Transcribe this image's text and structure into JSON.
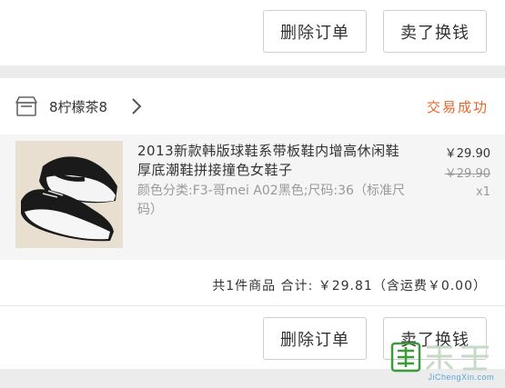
{
  "top_actions": {
    "delete_label": "删除订单",
    "sell_label": "卖了换钱"
  },
  "order": {
    "store_icon": "store-icon",
    "store_name": "8柠檬茶8",
    "status": "交易成功",
    "item": {
      "title": "2013新款韩版球鞋系带板鞋内增高休闲鞋厚底潮鞋拼接撞色女鞋子",
      "spec": "颜色分类:F3-哥mei A02黑色;尺码:36（标准尺码）",
      "price": "￥29.90",
      "original_price": "￥29.90",
      "quantity": "x1"
    },
    "summary": "共1件商品  合计: ￥29.81（含运费￥0.00）",
    "delete_label": "删除订单",
    "sell_label": "卖了换钱"
  },
  "watermark": {
    "url": "JiChengXin.com"
  },
  "colors": {
    "status": "#e8652a",
    "background": "#ececec"
  }
}
